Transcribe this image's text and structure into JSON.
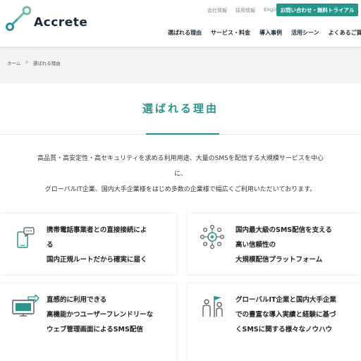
{
  "header": {
    "logo_text": "Accrete",
    "util_links": [
      "会社情報",
      "採用情報",
      "English"
    ],
    "cta_label": "お問い合わせ・無料トライアル",
    "nav": [
      "選ばれる理由",
      "サービス・料金",
      "導入事例",
      "活用シーン",
      "よくあるご質問"
    ]
  },
  "breadcrumb": {
    "home": "ホーム",
    "separator": ">",
    "current": "選ばれる理由"
  },
  "page_title": "選ばれる理由",
  "intro": {
    "line1": "高品質・高安定性・高セキュリティを求める利用用途、大量のSMSを配信する大規模サービスを中心",
    "line2": "に、",
    "line3": "グローバルIT企業、国内大手企業様をはじめ多数の企業様で幅広くご利用いただいております。"
  },
  "cards": [
    {
      "icon": "smartphone-chat-icon",
      "lines": [
        "携帯電話事業者との直接接続によ",
        "る",
        "国内正規ルートだから確実に届く"
      ]
    },
    {
      "icon": "network-gear-icon",
      "lines": [
        "国内最大級のSMS配信を支える",
        "高い信頼性の",
        "大規模配信プラットフォーム"
      ]
    },
    {
      "icon": "monitor-arrow-icon",
      "lines": [
        "直感的に利用できる",
        "高機能かつユーザーフレンドリー",
        "な",
        "ウェブ管理画面によるSMS配信"
      ]
    },
    {
      "icon": "people-flag-icon",
      "lines": [
        "グローバルIT企業と国内大手企業",
        "での豊富な導入実績と経験に基づ",
        "くSMSに関する様々なノウハウ"
      ]
    }
  ],
  "colors": {
    "accent": "#27958a",
    "logo_green": "#7cc0a8"
  }
}
